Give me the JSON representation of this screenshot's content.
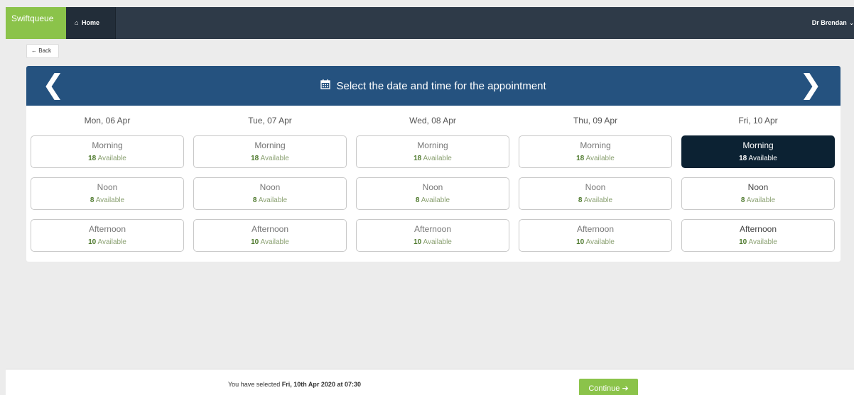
{
  "nav": {
    "brand": "Swiftqueue",
    "home_icon": "home-icon",
    "home_label": "Home",
    "user_name": "Dr Brendan",
    "user_chevron": "⌄"
  },
  "back": {
    "arrow": "←",
    "label": "Back"
  },
  "panel": {
    "title": "Select the date and time for the appointment",
    "prev_arrow": "❮",
    "next_arrow": "❯",
    "header_color": "#25527f"
  },
  "days": [
    {
      "label": "Mon, 06 Apr",
      "slots": [
        {
          "name": "Morning",
          "count": "18",
          "avail": "Available"
        },
        {
          "name": "Noon",
          "count": "8",
          "avail": "Available"
        },
        {
          "name": "Afternoon",
          "count": "10",
          "avail": "Available"
        }
      ]
    },
    {
      "label": "Tue, 07 Apr",
      "slots": [
        {
          "name": "Morning",
          "count": "18",
          "avail": "Available"
        },
        {
          "name": "Noon",
          "count": "8",
          "avail": "Available"
        },
        {
          "name": "Afternoon",
          "count": "10",
          "avail": "Available"
        }
      ]
    },
    {
      "label": "Wed, 08 Apr",
      "slots": [
        {
          "name": "Morning",
          "count": "18",
          "avail": "Available"
        },
        {
          "name": "Noon",
          "count": "8",
          "avail": "Available"
        },
        {
          "name": "Afternoon",
          "count": "10",
          "avail": "Available"
        }
      ]
    },
    {
      "label": "Thu, 09 Apr",
      "slots": [
        {
          "name": "Morning",
          "count": "18",
          "avail": "Available"
        },
        {
          "name": "Noon",
          "count": "8",
          "avail": "Available"
        },
        {
          "name": "Afternoon",
          "count": "10",
          "avail": "Available"
        }
      ]
    },
    {
      "label": "Fri, 10 Apr",
      "slots": [
        {
          "name": "Morning",
          "count": "18",
          "avail": "Available"
        },
        {
          "name": "Noon",
          "count": "8",
          "avail": "Available"
        },
        {
          "name": "Afternoon",
          "count": "10",
          "avail": "Available"
        }
      ]
    }
  ],
  "footer": {
    "prefix": "You have selected",
    "selection": "Fri, 10th Apr 2020 at 07:30",
    "continue_label": "Continue",
    "continue_arrow": "➔"
  },
  "colors": {
    "brand": "#8bc34a",
    "navbar": "#2e3a48",
    "selected_slot": "#0c2233",
    "available_count": "#4f7a2e"
  }
}
